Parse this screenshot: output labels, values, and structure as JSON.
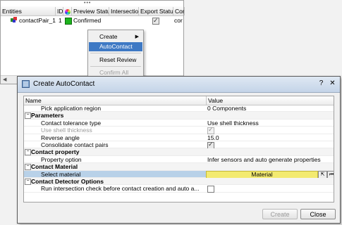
{
  "browser": {
    "columns": [
      "Entities",
      "ID",
      "",
      "Preview Status",
      "Intersection",
      "Export Status",
      "Cor"
    ],
    "row": {
      "name": "contactPair_1",
      "id": "1",
      "preview_status": "Confirmed",
      "export_status_checked": true,
      "cor": "cor"
    }
  },
  "context_menu": {
    "items": [
      {
        "label": "Create",
        "has_submenu": true
      },
      {
        "label": "AutoContact",
        "selected": true
      },
      {
        "label": "Reset Review"
      },
      {
        "label": "Confirm All",
        "disabled": true
      }
    ]
  },
  "dialog": {
    "title": "Create AutoContact",
    "columns": {
      "name": "Name",
      "value": "Value"
    },
    "rows": [
      {
        "type": "item",
        "name": "Pick application region",
        "value": "0 Components"
      },
      {
        "type": "group",
        "name": "Parameters"
      },
      {
        "type": "item",
        "name": "Contact tolerance type",
        "value": "Use shell thickness"
      },
      {
        "type": "item",
        "name": "Use shell thickness",
        "checkbox": true,
        "checked": true,
        "disabled": true
      },
      {
        "type": "item",
        "name": "Reverse angle",
        "value": "15.0"
      },
      {
        "type": "item",
        "name": "Consolidate contact pairs",
        "checkbox": true,
        "checked": true
      },
      {
        "type": "group",
        "name": "Contact property"
      },
      {
        "type": "item",
        "name": "Property option",
        "value": "Infer sensors and auto generate properties"
      },
      {
        "type": "group",
        "name": "Contact Material"
      },
      {
        "type": "item",
        "name": "Select material",
        "value": "Material",
        "highlighted": true
      },
      {
        "type": "group",
        "name": "Contact Detector Options"
      },
      {
        "type": "item",
        "name": "Run intersection check before contact creation and auto a...",
        "checkbox": true,
        "checked": false
      }
    ],
    "buttons": {
      "create": "Create",
      "close": "Close"
    }
  },
  "colors": {
    "selection": "#3e79c4",
    "highlight_row": "#b8d1e8",
    "material_field": "#f3ea70",
    "status_green": "#1db31d"
  }
}
